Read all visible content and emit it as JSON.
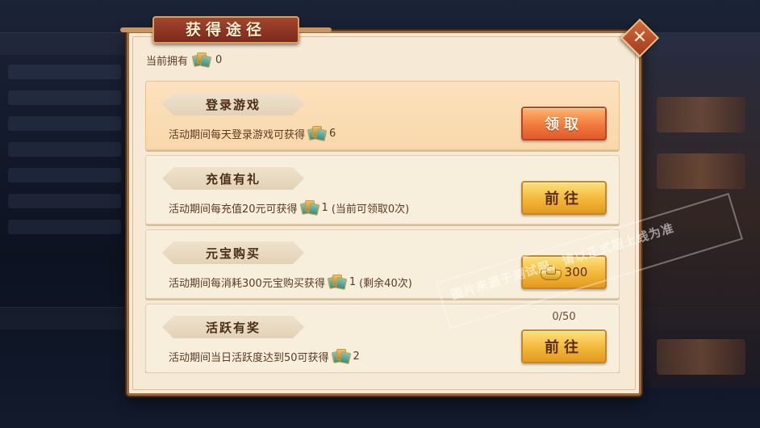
{
  "dialog": {
    "title": "获得途径",
    "close_icon": "close-icon",
    "owned_label": "当前拥有",
    "owned_count": "0",
    "token_icon": "lottery-ticket-icon"
  },
  "cards": [
    {
      "label": "登录游戏",
      "desc_prefix": "活动期间每天登录游戏可获得",
      "desc_amount": "6",
      "desc_suffix": "",
      "button": "领取",
      "button_style": "claim",
      "progress": ""
    },
    {
      "label": "充值有礼",
      "desc_prefix": "活动期间每充值20元可获得",
      "desc_amount": "1",
      "desc_suffix": "(当前可领取0次)",
      "button": "前往",
      "button_style": "go",
      "progress": ""
    },
    {
      "label": "元宝购买",
      "desc_prefix": "活动期间每消耗300元宝购买获得",
      "desc_amount": "1",
      "desc_suffix": "(剩余40次)",
      "button": "300",
      "button_style": "price",
      "button_icon": "gold-ingot-icon",
      "progress": ""
    },
    {
      "label": "活跃有奖",
      "desc_prefix": "活动期间当日活跃度达到50可获得",
      "desc_amount": "2",
      "desc_suffix": "",
      "button": "前往",
      "button_style": "go",
      "progress": "0/50"
    }
  ],
  "watermark": "图片来源于测试服，请以正式服上线为准",
  "colors": {
    "panel": "#f6ead6",
    "border": "#9a6a3a",
    "title_plate": "#8e3522",
    "claim_button": "#f17a3e",
    "go_button": "#f2b838"
  }
}
